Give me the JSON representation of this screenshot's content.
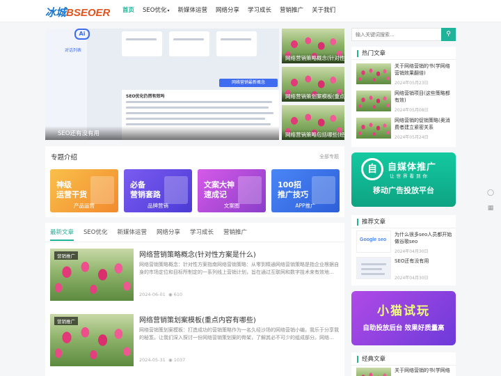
{
  "header": {
    "logo_part1": "冰城",
    "logo_part2": "BSEOER",
    "nav": [
      {
        "label": "首页",
        "active": true
      },
      {
        "label": "SEO优化",
        "has_dropdown": true
      },
      {
        "label": "新媒体运营"
      },
      {
        "label": "网络分享"
      },
      {
        "label": "学习成长"
      },
      {
        "label": "营销推广"
      },
      {
        "label": "关于我们"
      }
    ]
  },
  "hero": {
    "main_caption": "SEO还有没有用",
    "main_logo": "Ai",
    "main_sidebar_item": "对话列表",
    "main_button": "网络营销最新概念",
    "main_doc_title": "SEO优化仍然有效吗",
    "side": [
      {
        "caption": "网络营销策略概念(针对性方…"
      },
      {
        "caption": "网络营销策划案模板(重点内…"
      },
      {
        "caption": "网络营销策略包括哪些(经验…"
      }
    ]
  },
  "topics": {
    "title": "专题介绍",
    "more": "全部专题",
    "items": [
      {
        "line1": "神级",
        "line2": "运营干货",
        "label": "产品运营"
      },
      {
        "line1": "必备",
        "line2": "营销套路",
        "label": "品牌营销"
      },
      {
        "line1": "文案大神",
        "line2": "速成记",
        "label": "文案圈"
      },
      {
        "line1": "100招",
        "line2": "推广技巧",
        "label": "APP推广"
      }
    ]
  },
  "articles": {
    "tabs": [
      "最新文章",
      "SEO优化",
      "新媒体运营",
      "网络分享",
      "学习成长",
      "营销推广"
    ],
    "active_tab": 0,
    "items": [
      {
        "tag": "营销推广",
        "title": "网络营销策略概念(针对性方案是什么)",
        "desc": "网络营销策略概念：针对性方案指南网络营销策略：从零到精通网络营销策略是指企业根据自身的市场定位和目标所制定的一系列线上营销计划，旨在通过互联网和数字技术来有效地…",
        "date": "2024-06-01",
        "views": "610"
      },
      {
        "tag": "营销推广",
        "title": "网络营销策划案模板(重点内容有哪些)",
        "desc": "网络营销策划案模板：打造成功的营销策略作为一名久经沙场的网络营销小编，我乐于分享我的秘笈。让我们深入探讨一份网络营销策划案的骨架，了解其必不可少的组成部分。网络…",
        "date": "2024-05-31",
        "views": "1037"
      }
    ]
  },
  "sidebar": {
    "search_placeholder": "输入关键词搜索...",
    "hot": {
      "title": "热门文章",
      "items": [
        {
          "title": "关于网络营销的书(学网络营销效果翻倍)",
          "date": "2024年05月23日"
        },
        {
          "title": "网络营销项目(这些策略都有效)",
          "date": "2024年05月08日"
        },
        {
          "title": "网络营销的促销策略(奥消费者建立紧密关系",
          "date": "2024年05月24日"
        }
      ]
    },
    "banner1": {
      "logo": "自",
      "title": "自媒体推广",
      "sub": "让世界看到你",
      "main": "移动广告投放平台"
    },
    "recommend": {
      "title": "推荐文章",
      "items": [
        {
          "title": "为什么很多seo人员都开始做谷歌seo",
          "date": "2024年04月30日",
          "thumb": "Google seo"
        },
        {
          "title": "SEO还有没有用",
          "date": "2024年04月30日",
          "thumb": ""
        }
      ]
    },
    "banner2": {
      "title": "小猫试玩",
      "main": "自助投放后台 效果好质量高"
    },
    "classic": {
      "title": "经典文章",
      "items": [
        {
          "title": "关于网络营销的书(学网络"
        }
      ]
    }
  },
  "colors": {
    "accent": "#1fb39a",
    "logo_blue": "#1677d2",
    "logo_orange": "#e0531f"
  },
  "icons": {
    "search": "search-icon",
    "views": "eye-icon",
    "chat": "chat-icon",
    "qrcode": "qrcode-icon"
  }
}
